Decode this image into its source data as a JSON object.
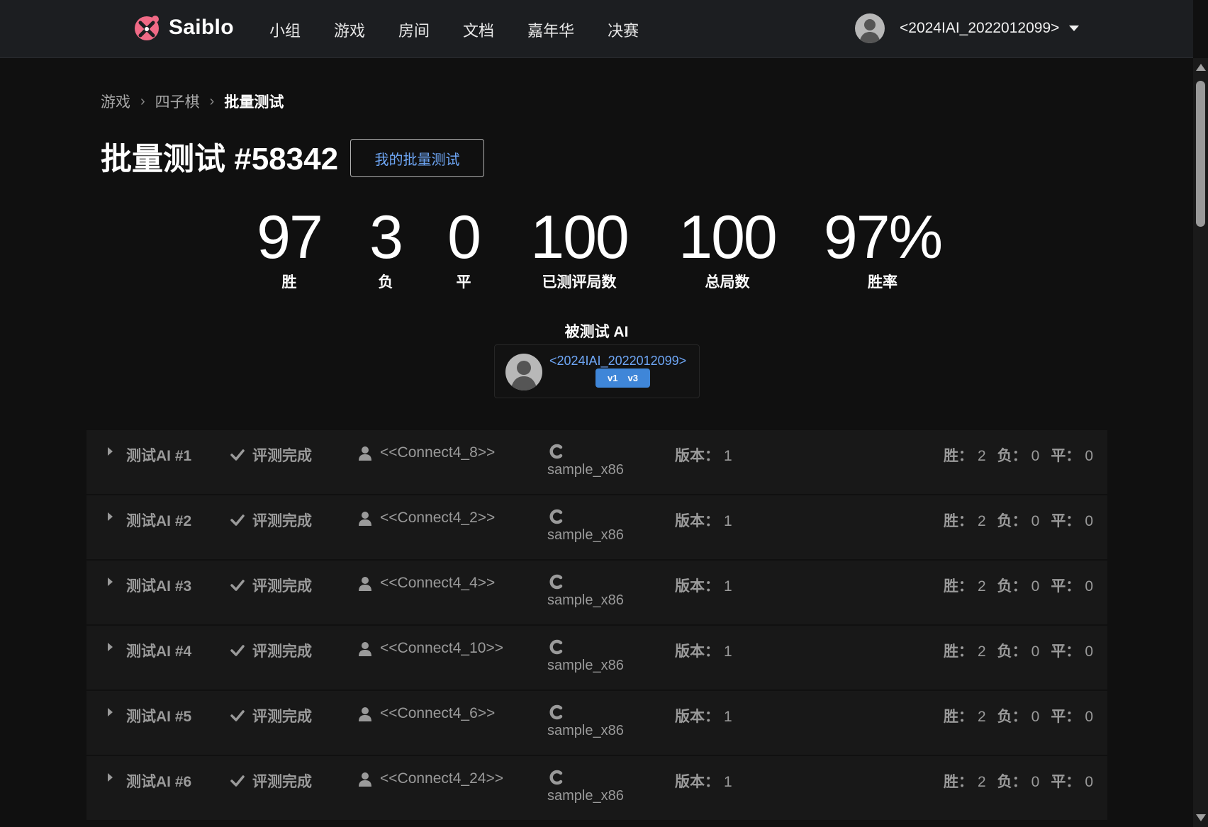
{
  "nav": {
    "brand": "Saiblo",
    "links": [
      "小组",
      "游戏",
      "房间",
      "文档",
      "嘉年华",
      "决赛"
    ],
    "user_name": "<2024IAI_2022012099>"
  },
  "breadcrumb": [
    "游戏",
    "四子棋",
    "批量测试"
  ],
  "title": "批量测试 #58342",
  "my_tests_button": "我的批量测试",
  "stats": [
    {
      "value": "97",
      "label": "胜"
    },
    {
      "value": "3",
      "label": "负"
    },
    {
      "value": "0",
      "label": "平"
    },
    {
      "value": "100",
      "label": "已测评局数"
    },
    {
      "value": "100",
      "label": "总局数"
    },
    {
      "value": "97%",
      "label": "胜率"
    }
  ],
  "tested_ai": {
    "heading": "被测试 AI",
    "name": "<2024IAI_2022012099>",
    "versions": [
      "v1",
      "v3"
    ]
  },
  "colors": {
    "accent": "#6ea6f5",
    "badge": "#3f86d8",
    "background": "#101010",
    "navbar": "#1c1e21",
    "row": "#181818"
  },
  "tests": [
    {
      "title": "测试AI #1",
      "status": "评测完成",
      "user": "<<Connect4_8>>",
      "code": "sample_x86",
      "version_label": "版本：",
      "version": "1",
      "win_label": "胜：",
      "win": "2",
      "loss_label": "负：",
      "loss": "0",
      "draw_label": "平：",
      "draw": "0"
    },
    {
      "title": "测试AI #2",
      "status": "评测完成",
      "user": "<<Connect4_2>>",
      "code": "sample_x86",
      "version_label": "版本：",
      "version": "1",
      "win_label": "胜：",
      "win": "2",
      "loss_label": "负：",
      "loss": "0",
      "draw_label": "平：",
      "draw": "0"
    },
    {
      "title": "测试AI #3",
      "status": "评测完成",
      "user": "<<Connect4_4>>",
      "code": "sample_x86",
      "version_label": "版本：",
      "version": "1",
      "win_label": "胜：",
      "win": "2",
      "loss_label": "负：",
      "loss": "0",
      "draw_label": "平：",
      "draw": "0"
    },
    {
      "title": "测试AI #4",
      "status": "评测完成",
      "user": "<<Connect4_10>>",
      "code": "sample_x86",
      "version_label": "版本：",
      "version": "1",
      "win_label": "胜：",
      "win": "2",
      "loss_label": "负：",
      "loss": "0",
      "draw_label": "平：",
      "draw": "0"
    },
    {
      "title": "测试AI #5",
      "status": "评测完成",
      "user": "<<Connect4_6>>",
      "code": "sample_x86",
      "version_label": "版本：",
      "version": "1",
      "win_label": "胜：",
      "win": "2",
      "loss_label": "负：",
      "loss": "0",
      "draw_label": "平：",
      "draw": "0"
    },
    {
      "title": "测试AI #6",
      "status": "评测完成",
      "user": "<<Connect4_24>>",
      "code": "sample_x86",
      "version_label": "版本：",
      "version": "1",
      "win_label": "胜：",
      "win": "2",
      "loss_label": "负：",
      "loss": "0",
      "draw_label": "平：",
      "draw": "0"
    }
  ]
}
